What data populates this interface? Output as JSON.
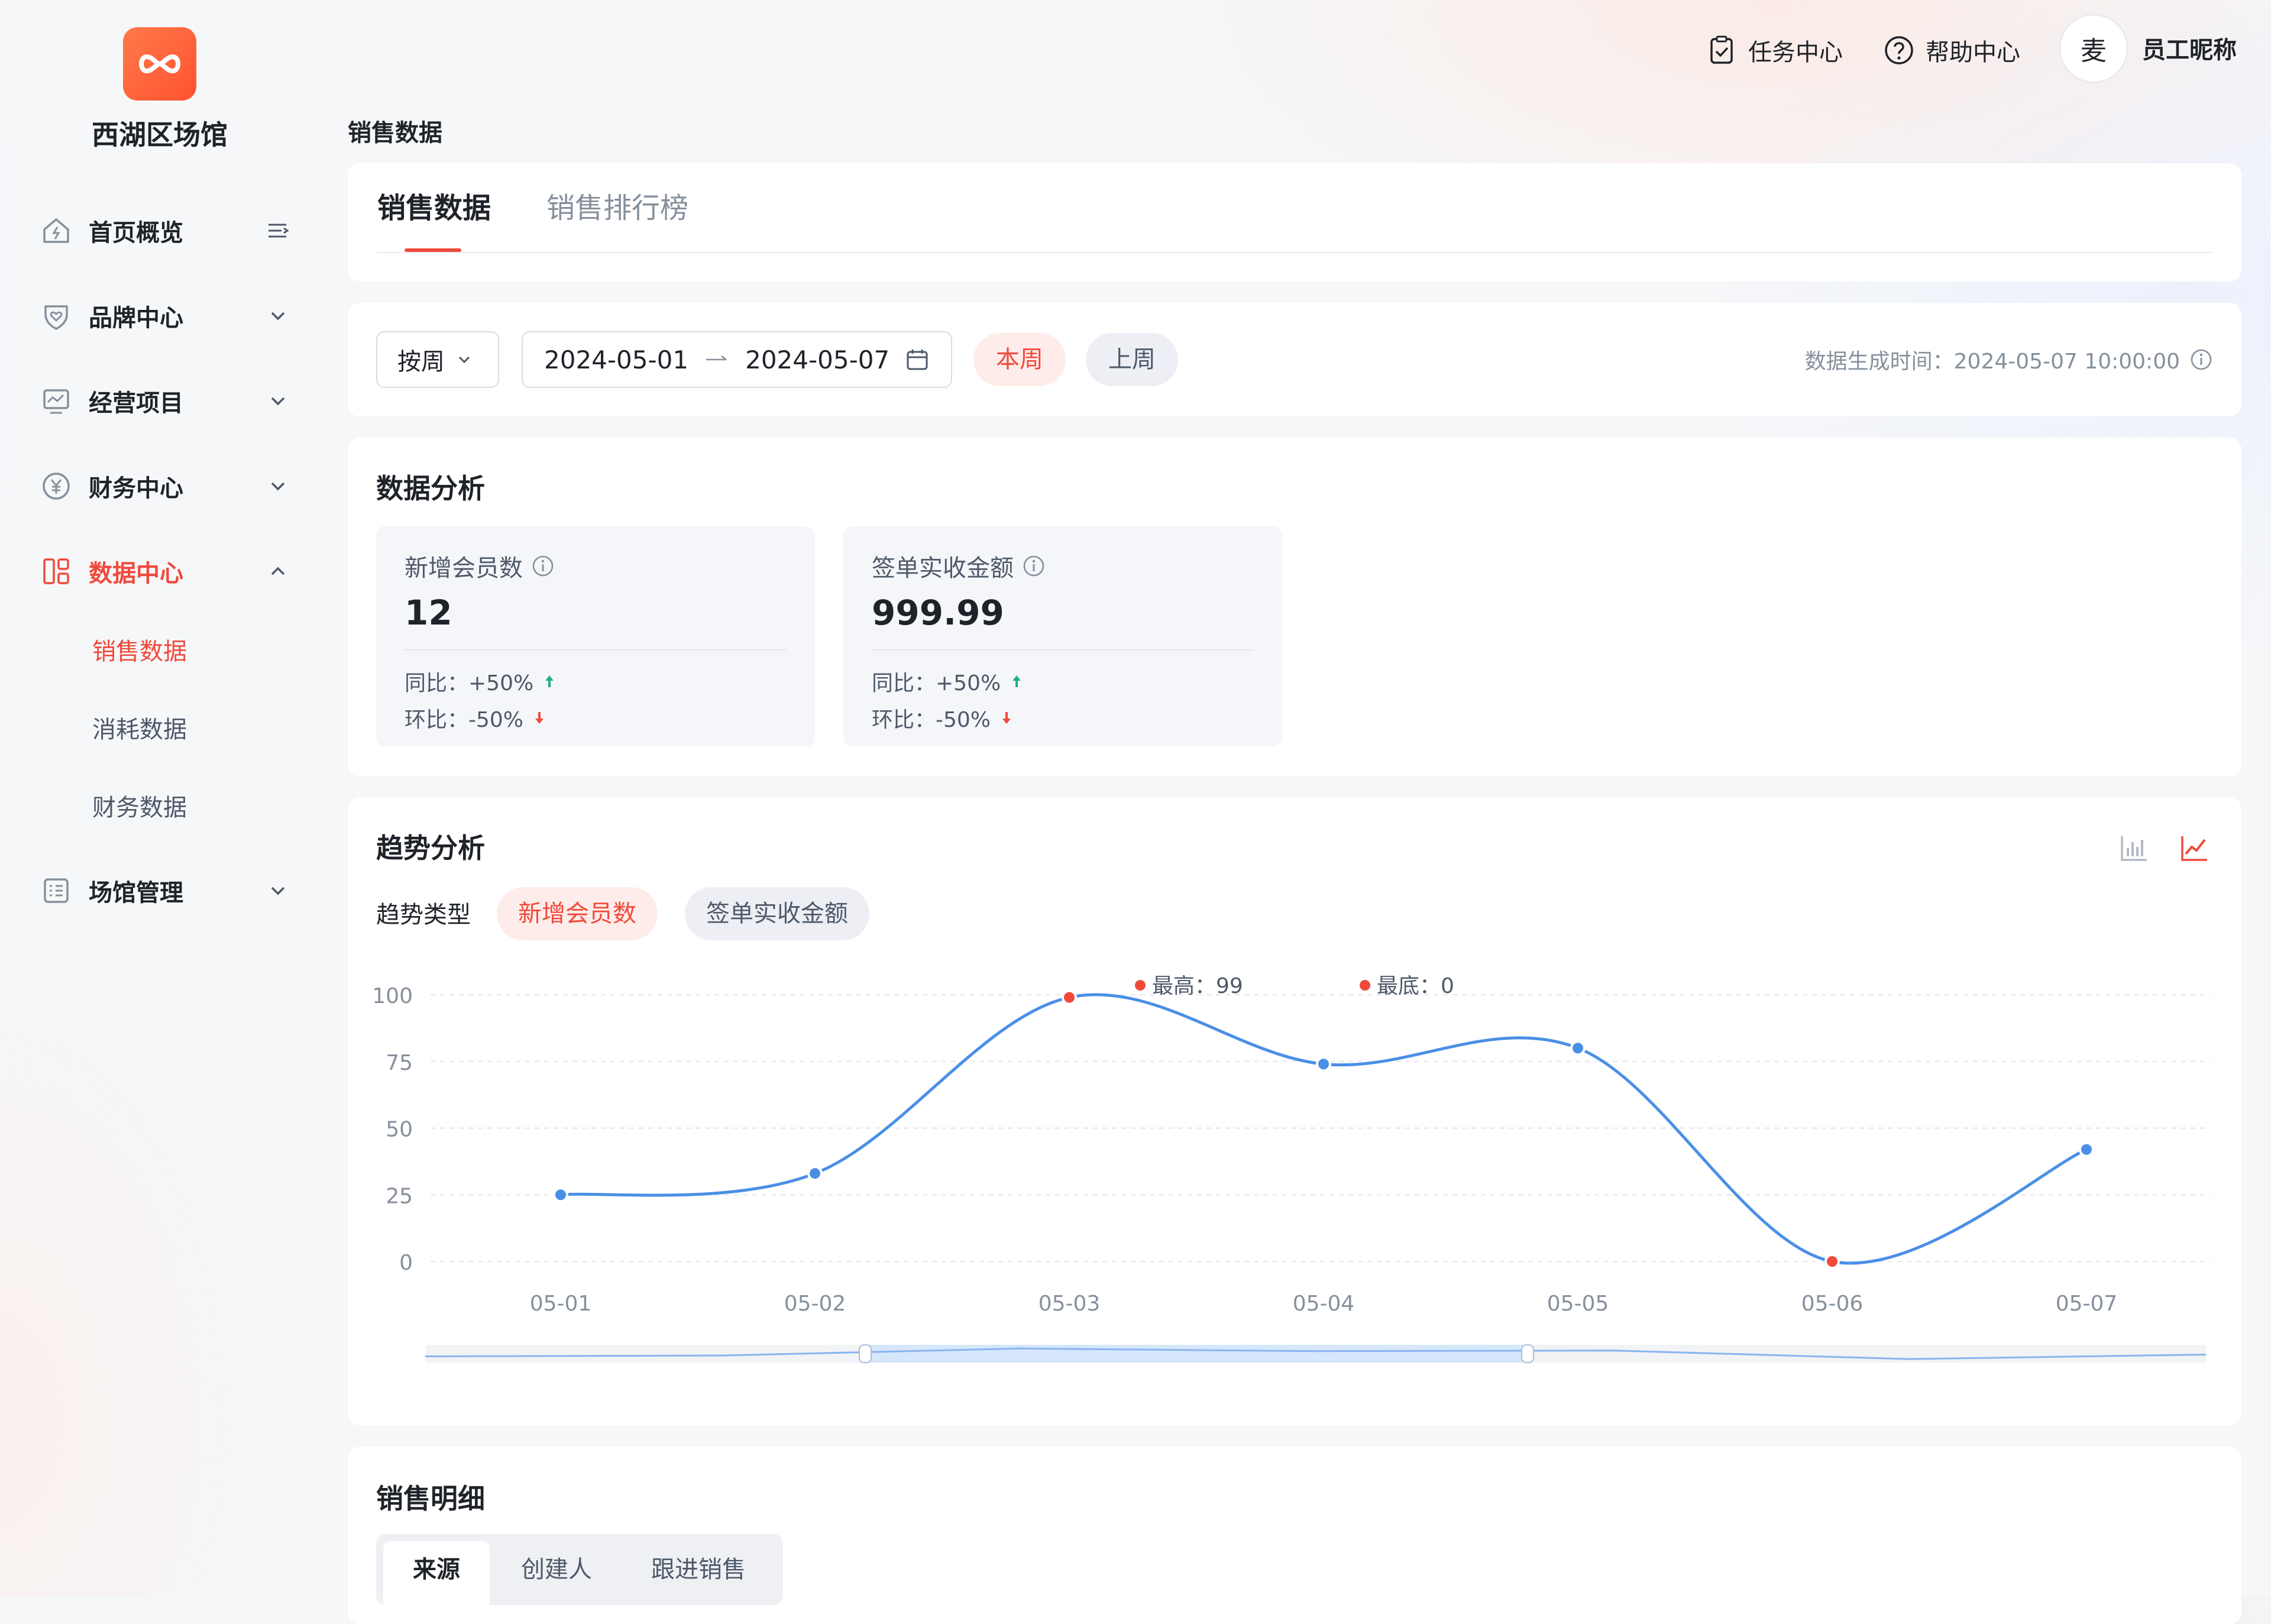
{
  "sidebar": {
    "venue_name": "西湖区场馆",
    "items": [
      {
        "label": "首页概览",
        "icon": "home-icon"
      },
      {
        "label": "品牌中心",
        "icon": "heart-shield-icon"
      },
      {
        "label": "经营项目",
        "icon": "monitor-icon"
      },
      {
        "label": "财务中心",
        "icon": "yuan-icon"
      },
      {
        "label": "数据中心",
        "icon": "dashboard-icon"
      },
      {
        "label": "场馆管理",
        "icon": "list-icon"
      }
    ],
    "data_center_sub": [
      "销售数据",
      "消耗数据",
      "财务数据"
    ]
  },
  "header": {
    "task_center": "任务中心",
    "help_center": "帮助中心",
    "avatar_text": "麦",
    "user_name": "员工昵称"
  },
  "page_title": "销售数据",
  "tabs": [
    "销售数据",
    "销售排行榜"
  ],
  "filter": {
    "period_select": "按周",
    "date_start": "2024-05-01",
    "date_end": "2024-05-07",
    "this_week": "本周",
    "last_week": "上周",
    "generated_time": "数据生成时间：2024-05-07 10:00:00"
  },
  "analysis": {
    "title": "数据分析",
    "metrics": [
      {
        "label": "新增会员数",
        "value": "12",
        "yoy": "同比：+50%",
        "mom": "环比：-50%"
      },
      {
        "label": "签单实收金额",
        "value": "999.99",
        "yoy": "同比：+50%",
        "mom": "环比：-50%"
      }
    ]
  },
  "trend": {
    "title": "趋势分析",
    "type_label": "趋势类型",
    "types": [
      "新增会员数",
      "签单实收金额"
    ],
    "selected_type": "新增会员数"
  },
  "chart_data": {
    "type": "line",
    "x": [
      "05-01",
      "05-02",
      "05-03",
      "05-04",
      "05-05",
      "05-06",
      "05-07"
    ],
    "series": [
      {
        "values": [
          25,
          33,
          99,
          74,
          80,
          0,
          42
        ]
      }
    ],
    "ylim": [
      0,
      100
    ],
    "yticks": [
      0,
      25,
      50,
      75,
      100
    ],
    "legend": [
      {
        "label": "最高：99",
        "color": "#f0493b"
      },
      {
        "label": "最底：0",
        "color": "#f0493b"
      }
    ],
    "highlight_indices": [
      2,
      5
    ],
    "line_color": "#4a8fe7",
    "highlight_color": "#f0493b",
    "grid": "dashed horizontal",
    "zoom_slider": true
  },
  "detail": {
    "title": "销售明细",
    "segments": [
      "来源",
      "创建人",
      "跟进销售"
    ]
  },
  "colors": {
    "accent": "#f0493b",
    "series": "#4a8fe7"
  }
}
